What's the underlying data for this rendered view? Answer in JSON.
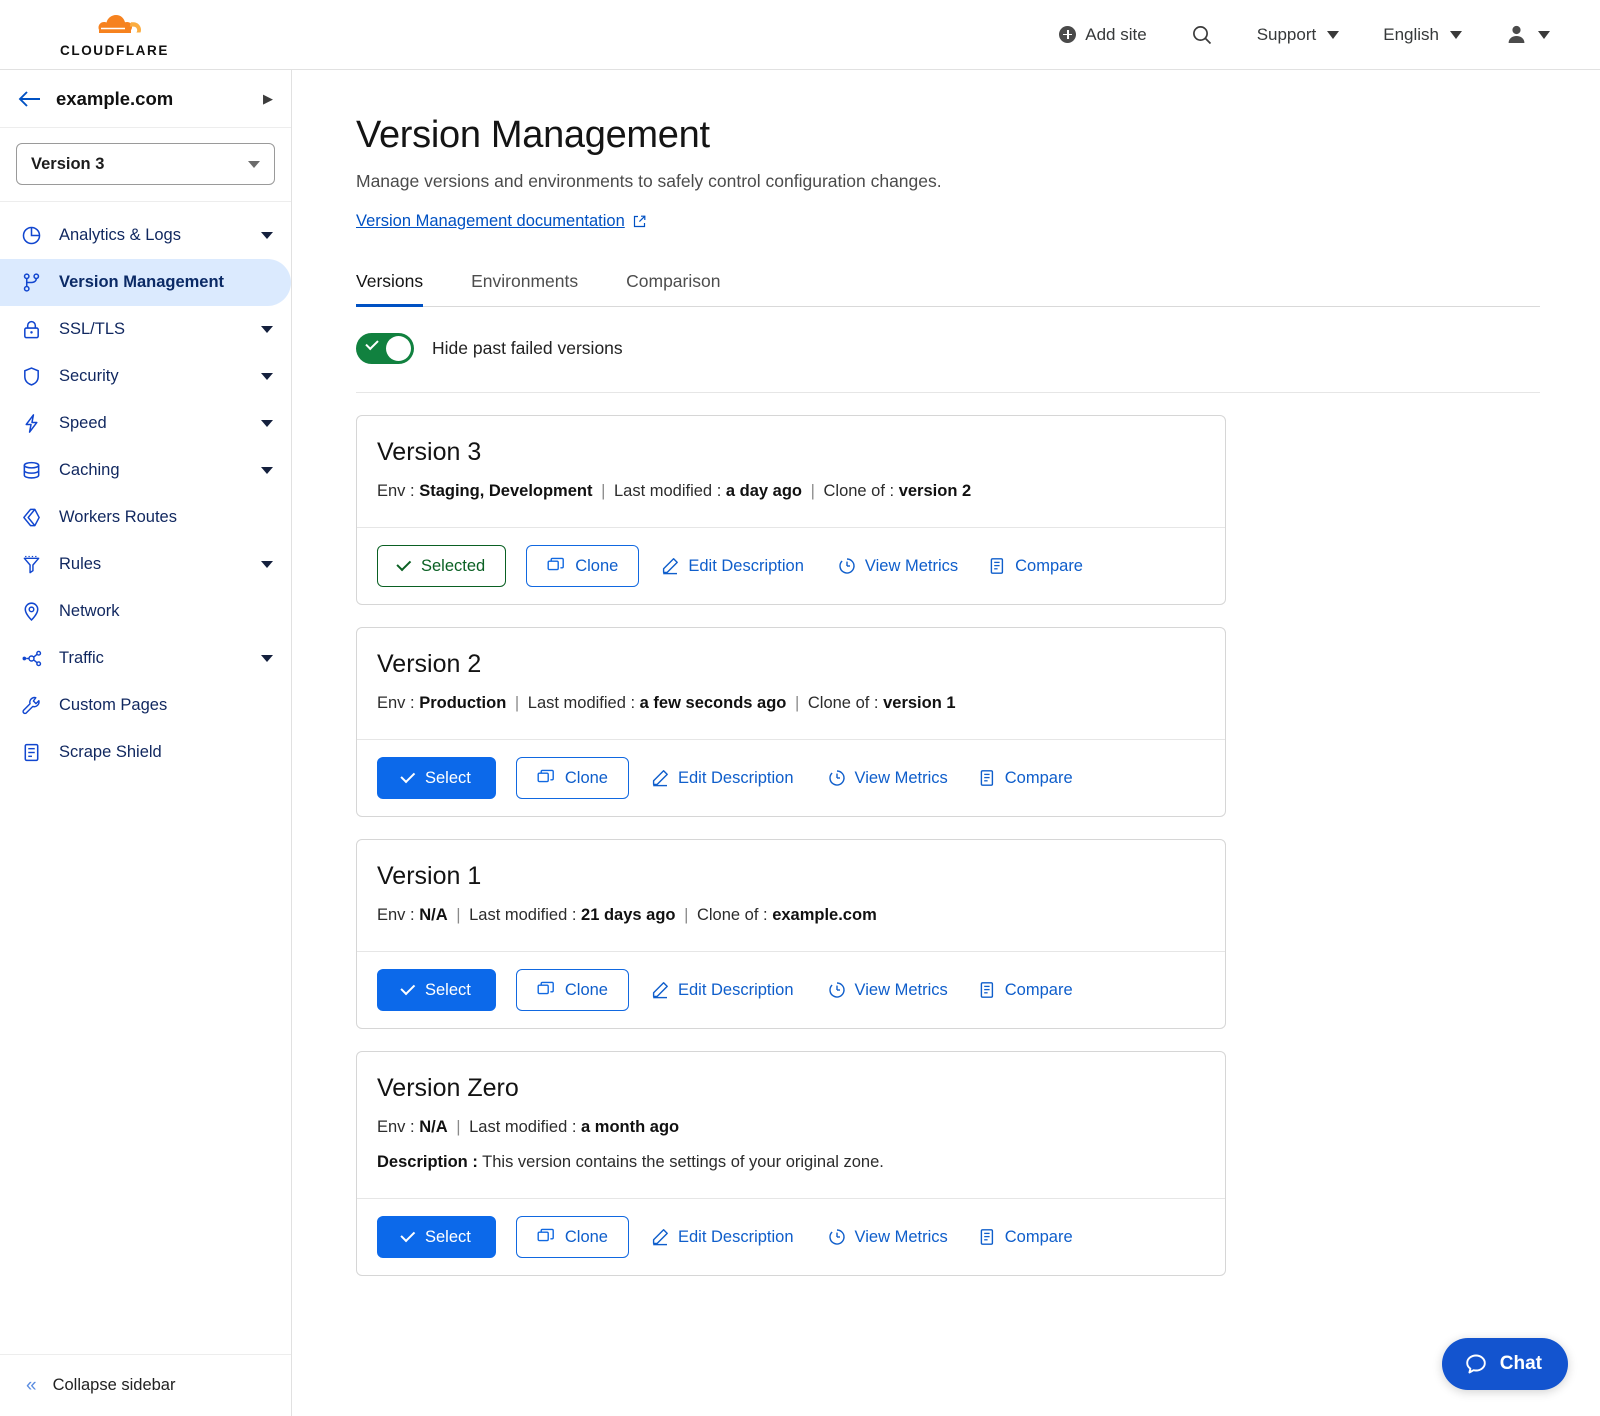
{
  "topbar": {
    "brand": "CLOUDFLARE",
    "add_site": "Add site",
    "search_icon": "search-icon",
    "support": "Support",
    "language": "English",
    "account_icon": "user-icon"
  },
  "sidebar": {
    "zone_name": "example.com",
    "back_icon": "arrow-left-icon",
    "zone_chevron_icon": "chevron-right-icon",
    "version_selector": "Version 3",
    "items": [
      {
        "label": "Analytics & Logs",
        "icon": "pie-chart-icon",
        "expandable": true,
        "active": false
      },
      {
        "label": "Version Management",
        "icon": "branch-icon",
        "expandable": false,
        "active": true
      },
      {
        "label": "SSL/TLS",
        "icon": "lock-icon",
        "expandable": true,
        "active": false
      },
      {
        "label": "Security",
        "icon": "shield-icon",
        "expandable": true,
        "active": false
      },
      {
        "label": "Speed",
        "icon": "bolt-icon",
        "expandable": true,
        "active": false
      },
      {
        "label": "Caching",
        "icon": "database-icon",
        "expandable": true,
        "active": false
      },
      {
        "label": "Workers Routes",
        "icon": "workers-icon",
        "expandable": false,
        "active": false
      },
      {
        "label": "Rules",
        "icon": "funnel-icon",
        "expandable": true,
        "active": false
      },
      {
        "label": "Network",
        "icon": "pin-icon",
        "expandable": false,
        "active": false
      },
      {
        "label": "Traffic",
        "icon": "traffic-icon",
        "expandable": true,
        "active": false
      },
      {
        "label": "Custom Pages",
        "icon": "wrench-icon",
        "expandable": false,
        "active": false
      },
      {
        "label": "Scrape Shield",
        "icon": "document-icon",
        "expandable": false,
        "active": false
      }
    ],
    "collapse_label": "Collapse sidebar",
    "collapse_icon": "chevron-double-left-icon"
  },
  "main": {
    "title": "Version Management",
    "subtitle": "Manage versions and environments to safely control configuration changes.",
    "doc_link": "Version Management documentation",
    "doc_link_icon": "external-link-icon",
    "tabs": [
      {
        "label": "Versions",
        "active": true
      },
      {
        "label": "Environments",
        "active": false
      },
      {
        "label": "Comparison",
        "active": false
      }
    ],
    "toggle": {
      "label": "Hide past failed versions",
      "on": true,
      "color": "#11813f"
    }
  },
  "labels": {
    "env": "Env :",
    "last_modified": "Last modified :",
    "clone_of": "Clone of :",
    "description": "Description :",
    "selected": "Selected",
    "select": "Select",
    "clone": "Clone",
    "edit_description": "Edit Description",
    "view_metrics": "View Metrics",
    "compare": "Compare"
  },
  "versions": [
    {
      "name": "Version 3",
      "env": "Staging, Development",
      "last_modified": "a day ago",
      "clone_of": "version 2",
      "description": null,
      "is_selected": true
    },
    {
      "name": "Version 2",
      "env": "Production",
      "last_modified": "a few seconds ago",
      "clone_of": "version 1",
      "description": null,
      "is_selected": false
    },
    {
      "name": "Version 1",
      "env": "N/A",
      "last_modified": "21 days ago",
      "clone_of": "example.com",
      "description": null,
      "is_selected": false
    },
    {
      "name": "Version Zero",
      "env": "N/A",
      "last_modified": "a month ago",
      "clone_of": null,
      "description": "This version contains the settings of your original zone.",
      "is_selected": false
    }
  ],
  "chat": {
    "label": "Chat",
    "icon": "chat-bubble-icon",
    "color": "#1354cf"
  },
  "colors": {
    "accent_blue": "#0051c3",
    "button_blue": "#0c69ea",
    "link_blue": "#0f5ecb",
    "selected_green": "#0a6023",
    "toggle_green": "#11813f",
    "brand_orange": "#f6821f",
    "sidebar_active_bg": "#dbeafe"
  }
}
